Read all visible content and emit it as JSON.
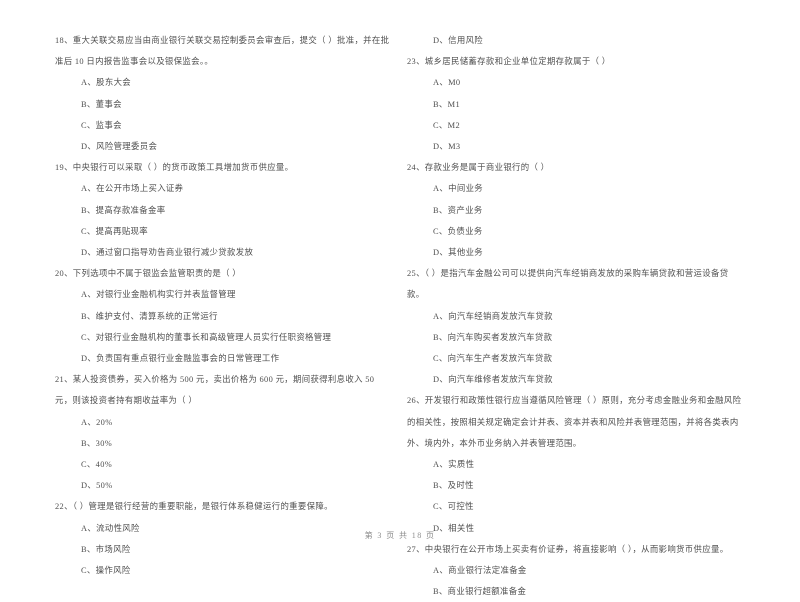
{
  "footer": {
    "page_label": "第 3 页  共 18 页"
  },
  "left_column": [
    {
      "number": "18",
      "stem": "18、重大关联交易应当由商业银行关联交易控制委员会审查后，提交（      ）批准，并在批准后 10 日内报告监事会以及银保监会。。",
      "options": [
        "A、股东大会",
        "B、董事会",
        "C、监事会",
        "D、风险管理委员会"
      ]
    },
    {
      "number": "19",
      "stem": "19、中央银行可以采取（      ）的货币政策工具增加货币供应量。",
      "options": [
        "A、在公开市场上买入证券",
        "B、提高存款准备金率",
        "C、提高再贴现率",
        "D、通过窗口指导劝告商业银行减少贷款发放"
      ]
    },
    {
      "number": "20",
      "stem": "20、下列选项中不属于银监会监管职责的是（      ）",
      "options": [
        "A、对银行业金融机构实行并表监督管理",
        "B、维护支付、清算系统的正常运行",
        "C、对银行业金融机构的董事长和高级管理人员实行任职资格管理",
        "D、负责国有重点银行业金融监事会的日常管理工作"
      ]
    },
    {
      "number": "21",
      "stem": "21、某人投资债券，买入价格为 500 元，卖出价格为 600 元，期间获得利息收入 50 元，则该投资者持有期收益率为（      ）",
      "options": [
        "A、20%",
        "B、30%",
        "C、40%",
        "D、50%"
      ]
    },
    {
      "number": "22",
      "stem": "22、（      ）管理是银行经营的重要职能，是银行体系稳健运行的重要保障。",
      "options": [
        "A、流动性风险",
        "B、市场风险",
        "C、操作风险"
      ]
    }
  ],
  "right_column": [
    {
      "number": "22-cont",
      "stem": "",
      "options": [
        "D、信用风险"
      ]
    },
    {
      "number": "23",
      "stem": "23、城乡居民储蓄存款和企业单位定期存款属于（      ）",
      "options": [
        "A、M0",
        "B、M1",
        "C、M2",
        "D、M3"
      ]
    },
    {
      "number": "24",
      "stem": "24、存款业务是属于商业银行的（      ）",
      "options": [
        "A、中间业务",
        "B、资产业务",
        "C、负债业务",
        "D、其他业务"
      ]
    },
    {
      "number": "25",
      "stem": "25、（      ）是指汽车金融公司可以提供向汽车经销商发放的采购车辆贷款和营运设备贷款。",
      "options": [
        "A、向汽车经销商发放汽车贷款",
        "B、向汽车购买者发放汽车贷款",
        "C、向汽车生产者发放汽车贷款",
        "D、向汽车维修者发放汽车贷款"
      ]
    },
    {
      "number": "26",
      "stem": "26、开发银行和政策性银行应当遵循风险管理（      ）原则，充分考虑金融业务和金融风险的相关性，按照相关规定确定会计并表、资本并表和风险并表管理范围，并将各类表内外、境内外，本外币业务纳入并表管理范围。",
      "options": [
        "A、实质性",
        "B、及时性",
        "C、可控性",
        "D、相关性"
      ]
    },
    {
      "number": "27",
      "stem": "27、中央银行在公开市场上买卖有价证券，将直接影响（      ），从而影响货币供应量。",
      "options": [
        "A、商业银行法定准备金",
        "B、商业银行超额准备金"
      ]
    }
  ]
}
